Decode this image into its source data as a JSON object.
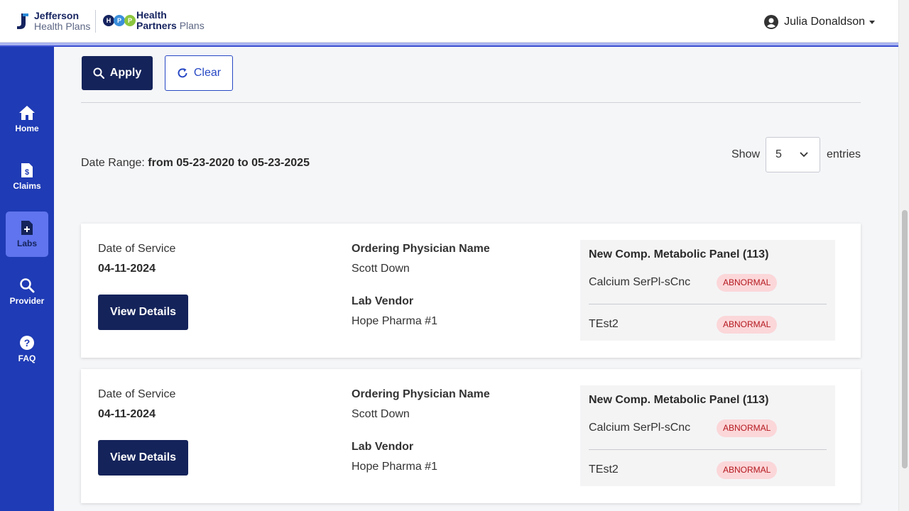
{
  "header": {
    "brand1_line1": "Jefferson",
    "brand1_line2": "Health Plans",
    "brand2_letters": [
      "H",
      "P",
      "P"
    ],
    "brand2_line1": "Health",
    "brand2_line2a": "Partners",
    "brand2_line2b": " Plans",
    "user_name": "Julia Donaldson"
  },
  "sidebar": {
    "items": [
      {
        "label": "Home",
        "icon": "home-icon"
      },
      {
        "label": "Claims",
        "icon": "claims-document-icon"
      },
      {
        "label": "Labs",
        "icon": "labs-document-icon",
        "active": true
      },
      {
        "label": "Provider",
        "icon": "search-icon"
      },
      {
        "label": "FAQ",
        "icon": "question-icon"
      }
    ]
  },
  "filters": {
    "apply_label": "Apply",
    "clear_label": "Clear"
  },
  "date_range": {
    "prefix": "Date Range: ",
    "value": "from 05-23-2020 to 05-23-2025"
  },
  "pagination": {
    "show_label": "Show",
    "entries_value": "5",
    "entries_label": "entries"
  },
  "labs": [
    {
      "dos_label": "Date of Service",
      "dos_value": "04-11-2024",
      "view_label": "View Details",
      "physician_label": "Ordering Physician Name",
      "physician_value": "Scott Down",
      "vendor_label": "Lab Vendor",
      "vendor_value": "Hope Pharma #1",
      "panel_title": "New Comp. Metabolic Panel (113)",
      "tests": [
        {
          "name": "Calcium SerPl-sCnc",
          "status": "ABNORMAL"
        },
        {
          "name": "TEst2",
          "status": "ABNORMAL"
        }
      ]
    },
    {
      "dos_label": "Date of Service",
      "dos_value": "04-11-2024",
      "view_label": "View Details",
      "physician_label": "Ordering Physician Name",
      "physician_value": "Scott Down",
      "vendor_label": "Lab Vendor",
      "vendor_value": "Hope Pharma #1",
      "panel_title": "New Comp. Metabolic Panel (113)",
      "tests": [
        {
          "name": "Calcium SerPl-sCnc",
          "status": "ABNORMAL"
        },
        {
          "name": "TEst2",
          "status": "ABNORMAL"
        }
      ]
    }
  ],
  "colors": {
    "sidebar_bg": "#1f3bb5",
    "sidebar_active": "#5f74ee",
    "primary_button": "#14235a",
    "badge_bg": "#fbd7d9",
    "badge_text": "#b4181f"
  }
}
